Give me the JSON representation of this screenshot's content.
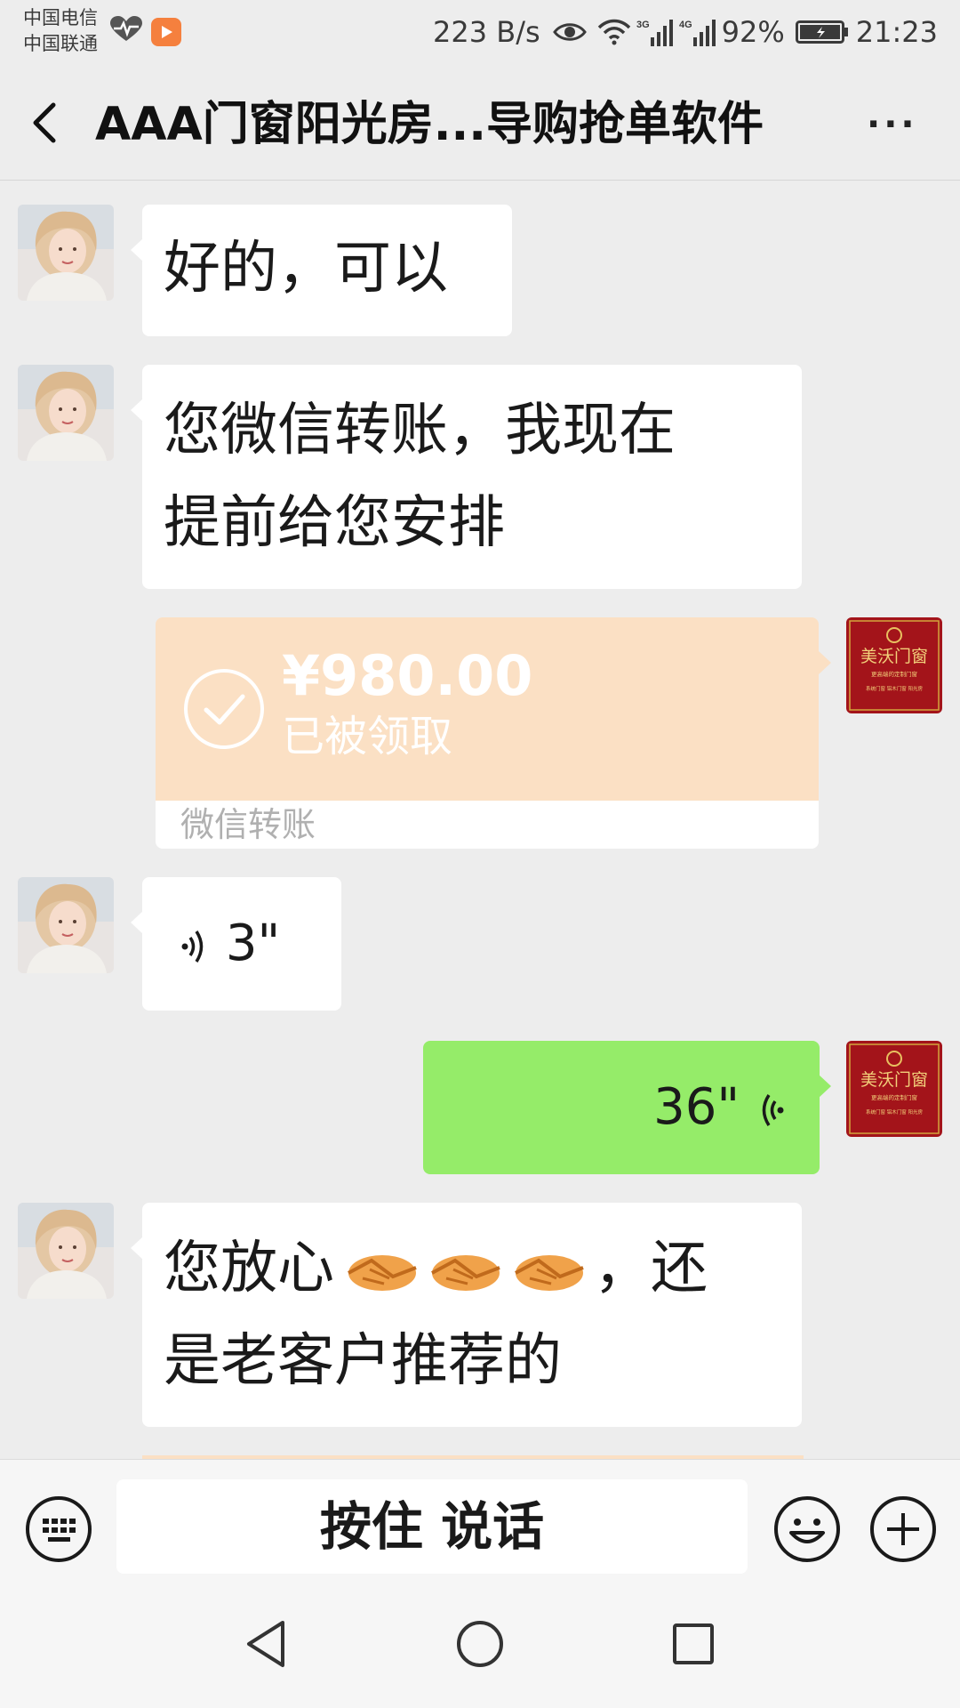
{
  "status_bar": {
    "carrier1": "中国电信",
    "carrier2": "中国联通",
    "speed": "223 B/s",
    "battery": "92%",
    "time": "21:23",
    "net_3g": "3G",
    "net_4g": "4G"
  },
  "nav": {
    "title": "AAA门窗阳光房...导购抢单软件",
    "more": "···"
  },
  "messages": {
    "m1": "好的，可以",
    "m2_line1": "您微信转账，我现在",
    "m2_line2": "提前给您安排",
    "transfer_amount": "¥980.00",
    "transfer_status": "已被领取",
    "transfer_label": "微信转账",
    "voice_in": "3\"",
    "voice_out": "36\"",
    "m5_line1_a": "您放心",
    "m5_line1_b": "，还",
    "m5_line2": "是老客户推荐的"
  },
  "my_avatar": {
    "brand": "美沃门窗",
    "tagline": "更高端的定制门窗",
    "sub": "系统门窗 铝木门窗 阳光房"
  },
  "input": {
    "hold_to_talk": "按住 说话"
  },
  "colors": {
    "bg": "#ededed",
    "green_bubble": "#95ec69",
    "transfer_orange": "#fbe0c4",
    "avatar_red": "#a3141a"
  }
}
